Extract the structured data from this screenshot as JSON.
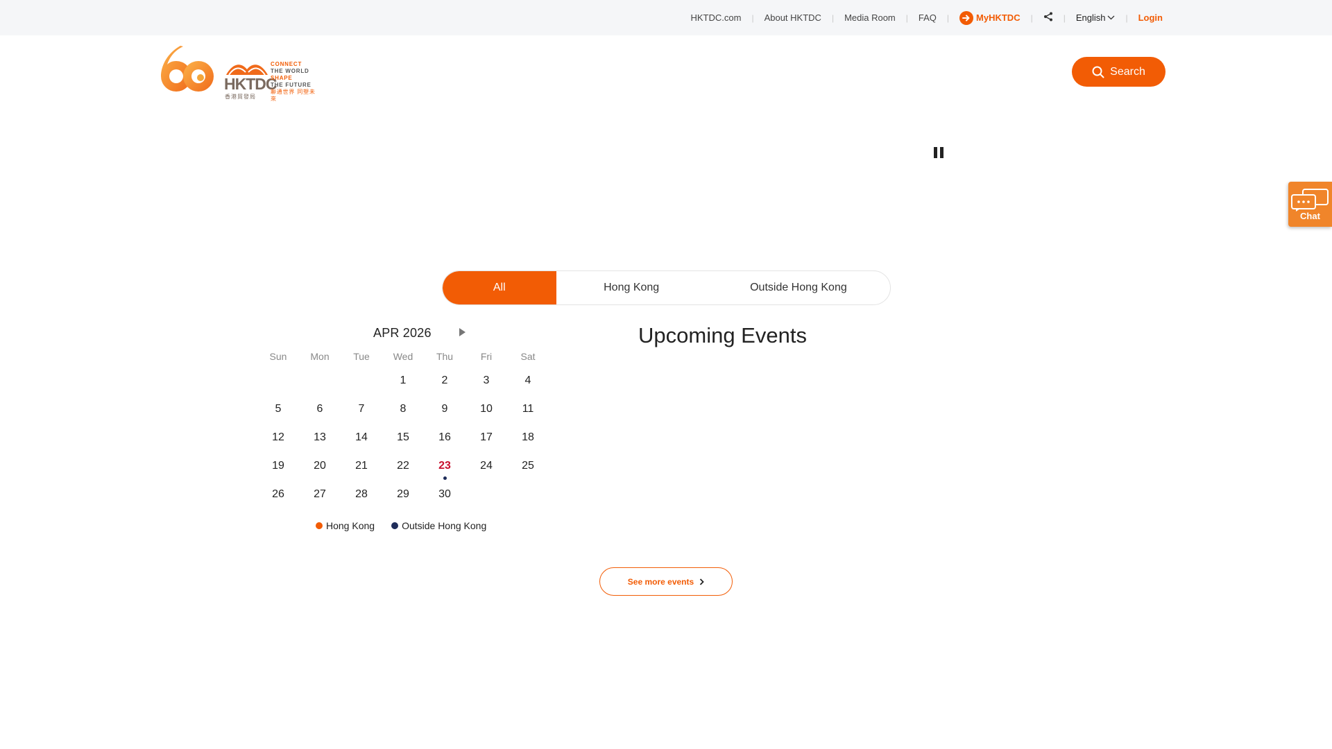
{
  "topnav": {
    "links": [
      "HKTDC.com",
      "About HKTDC",
      "Media Room",
      "FAQ"
    ],
    "my_label": "MyHKTDC",
    "share_icon": "share-icon",
    "language": "English",
    "login": "Login"
  },
  "logo": {
    "number": "60",
    "brand": "HKTDC",
    "brand_cn": "香港貿發局",
    "tagline": [
      "CONNECT",
      "THE WORLD",
      "SHAPE",
      "THE FUTURE"
    ],
    "tagline_cn": "聯通世界 同塑未來"
  },
  "header": {
    "search_label": "Search"
  },
  "chat": {
    "label": "Chat"
  },
  "tabs": [
    {
      "label": "All",
      "active": true
    },
    {
      "label": "Hong Kong",
      "active": false
    },
    {
      "label": "Outside Hong Kong",
      "active": false
    }
  ],
  "calendar": {
    "month_label": "APR 2026",
    "weekdays": [
      "Sun",
      "Mon",
      "Tue",
      "Wed",
      "Thu",
      "Fri",
      "Sat"
    ],
    "weeks": [
      [
        "",
        "",
        "",
        "1",
        "2",
        "3",
        "4"
      ],
      [
        "5",
        "6",
        "7",
        "8",
        "9",
        "10",
        "11"
      ],
      [
        "12",
        "13",
        "14",
        "15",
        "16",
        "17",
        "18"
      ],
      [
        "19",
        "20",
        "21",
        "22",
        "23",
        "24",
        "25"
      ],
      [
        "26",
        "27",
        "28",
        "29",
        "30",
        "",
        ""
      ]
    ],
    "today": "23",
    "event_days_outside_hk": [
      "23"
    ],
    "legend": {
      "hong_kong": "Hong Kong",
      "outside": "Outside Hong Kong"
    }
  },
  "events": {
    "heading": "Upcoming Events"
  },
  "see_more": "See more events",
  "colors": {
    "accent": "#f25c05",
    "today": "#c8102e",
    "outside_dot": "#1f2d5a"
  }
}
